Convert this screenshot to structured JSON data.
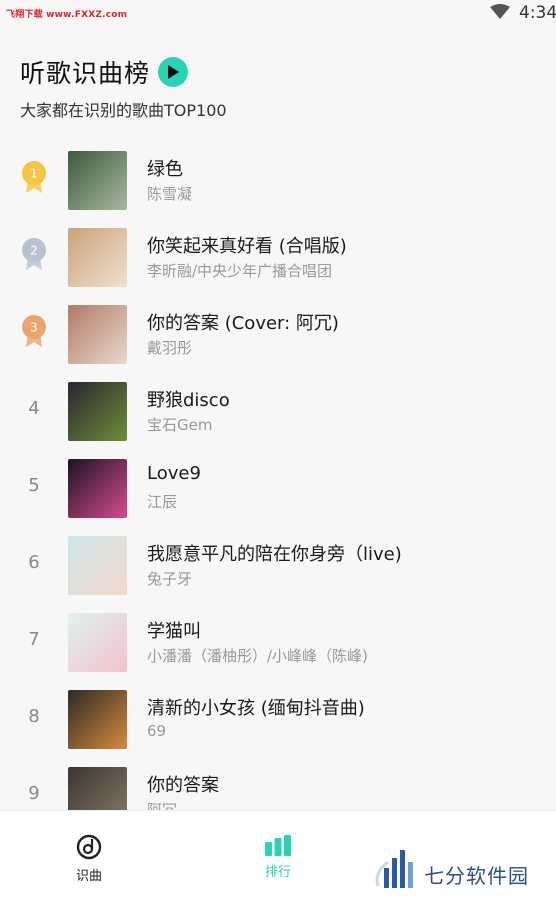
{
  "status_bar": {
    "watermark": "飞翔下载 www.FXXZ.com",
    "time": "4:34"
  },
  "header": {
    "title": "听歌识曲榜",
    "subtitle": "大家都在识别的歌曲TOP100"
  },
  "songs": [
    {
      "rank": "1",
      "medal": "gold",
      "title": "绿色",
      "artist": "陈雪凝",
      "cover_colors": [
        "#3d5a3e",
        "#a7b8a0"
      ]
    },
    {
      "rank": "2",
      "medal": "silver",
      "title": "你笑起来真好看 (合唱版)",
      "artist": "李昕融/中央少年广播合唱团",
      "cover_colors": [
        "#c9a27a",
        "#efe1cf"
      ]
    },
    {
      "rank": "3",
      "medal": "bronze",
      "title": "你的答案 (Cover: 阿冗)",
      "artist": "戴羽彤",
      "cover_colors": [
        "#b07a66",
        "#e9d8cf"
      ]
    },
    {
      "rank": "4",
      "medal": "",
      "title": "野狼disco",
      "artist": "宝石Gem",
      "cover_colors": [
        "#2a2430",
        "#6d8f3a"
      ]
    },
    {
      "rank": "5",
      "medal": "",
      "title": "Love9",
      "artist": "江辰",
      "cover_colors": [
        "#1a1422",
        "#d74b8e"
      ]
    },
    {
      "rank": "6",
      "medal": "",
      "title": "我愿意平凡的陪在你身旁（live)",
      "artist": "兔子牙",
      "cover_colors": [
        "#cfe6ec",
        "#f2d9c9"
      ]
    },
    {
      "rank": "7",
      "medal": "",
      "title": "学猫叫",
      "artist": "小潘潘（潘柚彤）/小峰峰（陈峰)",
      "cover_colors": [
        "#dff1ee",
        "#f4c2cf"
      ]
    },
    {
      "rank": "8",
      "medal": "",
      "title": "清新的小女孩 (缅甸抖音曲)",
      "artist": "69",
      "cover_colors": [
        "#2b2a28",
        "#d68a3c"
      ]
    },
    {
      "rank": "9",
      "medal": "",
      "title": "你的答案",
      "artist": "阿冗",
      "cover_colors": [
        "#3a3430",
        "#8a7a6a"
      ]
    }
  ],
  "bottom_nav": {
    "recognize_label": "识曲",
    "rank_label": "排行"
  },
  "logo_text": "七分软件园",
  "colors": {
    "accent": "#2ad3b3",
    "gold": "#f4c542",
    "silver": "#b8c3cf",
    "bronze": "#eaa56a"
  }
}
